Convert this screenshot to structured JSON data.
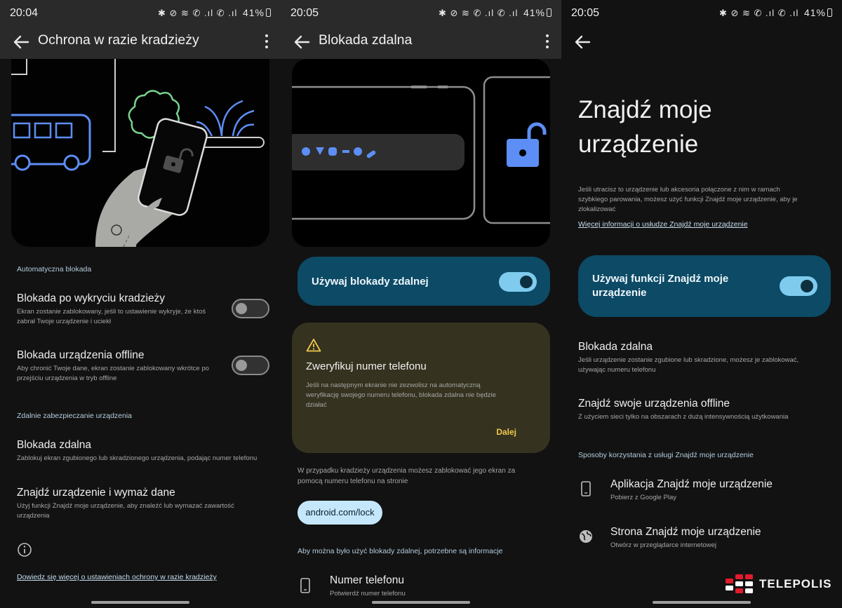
{
  "colors": {
    "panel_bg": "#121212",
    "appbar_bg": "#2a2a2a",
    "teal_card": "#0c4a66",
    "switch_on": "#7ecbee",
    "warning_card": "#35321f",
    "warning_accent": "#f2c94c",
    "pill_button": "#c5e7fb",
    "hero_accent_blue": "#5d8ef5"
  },
  "status_icons": "✱ ⊘ ≋ ✆ .ıl ✆ .ıl",
  "screen1": {
    "time": "20:04",
    "battery": "41%",
    "title": "Ochrona w razie kradzieży",
    "section_auto": "Automatyczna blokada",
    "theft_lock": {
      "title": "Blokada po wykryciu kradzieży",
      "sub_line1": "Ekran zostanie zablokowany, jeśli to ustawienie wykryje, że ktoś",
      "sub_line2": "zabrał Twoje urządzenie i uciekł",
      "enabled": false
    },
    "offline_lock": {
      "title": "Blokada urządzenia offline",
      "sub_line1": "Aby chronić Twoje dane, ekran zostanie zablokowany wkrótce po",
      "sub_line2": "przejściu urządzenia w tryb offline",
      "enabled": false
    },
    "section_remote": "Zdalnie zabezpieczanie urządzenia",
    "remote_lock": {
      "title": "Blokada zdalna",
      "sub": "Zablokuj ekran zgubionego lub skradzionego urządzenia, podając numer telefonu"
    },
    "find_erase": {
      "title": "Znajdź urządzenie i wymaż dane",
      "sub_line1": "Użyj funkcji Znajdź moje urządzenie, aby znaleźć lub wymazać zawartość",
      "sub_line2": "urządzenia"
    },
    "learn_more": "Dowiedz się więcej o ustawieniach ochrony w razie kradzieży"
  },
  "screen2": {
    "time": "20:05",
    "battery": "41%",
    "title": "Blokada zdalna",
    "use_toggle_label": "Używaj blokady zdalnej",
    "use_toggle_enabled": true,
    "warning": {
      "title": "Zweryfikuj numer telefonu",
      "body_line1": "Jeśli na następnym ekranie nie zezwolisz na automatyczną",
      "body_line2": "weryfikację swojego numeru telefonu, blokada zdalna nie będzie",
      "body_line3": "działać",
      "action": "Dalej"
    },
    "info_line1": "W przypadku kradzieży urządzenia możesz zablokować jego ekran za",
    "info_line2": "pomocą numeru telefonu na stronie",
    "lock_url": "android.com/lock",
    "requirements": "Aby można było użyć blokady zdalnej, potrzebne są informacje",
    "phone": {
      "title": "Numer telefonu",
      "sub": "Potwierdź numer telefonu"
    }
  },
  "screen3": {
    "time": "20:05",
    "battery": "41%",
    "heading_line1": "Znajdź moje",
    "heading_line2": "urządzenie",
    "intro_line1": "Jeśli utracisz to urządzenie lub akcesoria połączone z nim w ramach",
    "intro_line2": "szybkiego parowania, możesz użyć funkcji Znajdź moje urządzenie, aby je",
    "intro_line3": "zlokalizować",
    "more_info": "Więcej informacji o usłudze Znajdź moje urządzenie",
    "use_toggle_line1": "Używaj funkcji Znajdź moje",
    "use_toggle_line2": "urządzenie",
    "use_toggle_enabled": true,
    "remote_lock": {
      "title": "Blokada zdalna",
      "sub_line1": "Jeśli urządzenie zostanie zgubione lub skradzione, możesz je zablokować,",
      "sub_line2": "używając numeru telefonu"
    },
    "offline": {
      "title": "Znajdź swoje urządzenia offline",
      "sub": "Z użyciem sieci tylko na obszarach z dużą intensywnością użytkowania"
    },
    "section_ways": "Sposoby korzystania z usługi Znajdź moje urządzenie",
    "app": {
      "title": "Aplikacja Znajdź moje urządzenie",
      "sub": "Pobierz z Google Play"
    },
    "web": {
      "title": "Strona Znajdź moje urządzenie",
      "sub": "Otwórz w przeglądarce internetowej"
    }
  },
  "watermark": "TELEPOLIS"
}
